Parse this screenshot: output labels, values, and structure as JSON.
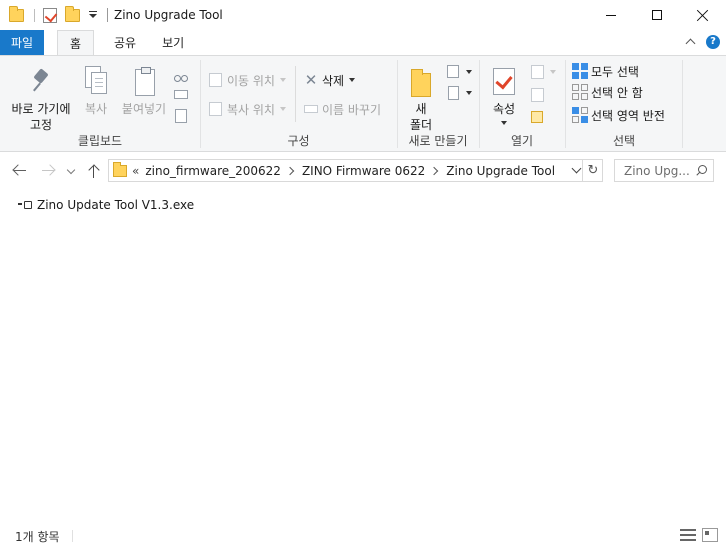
{
  "window": {
    "title": "Zino Upgrade Tool"
  },
  "ribbon_tabs": {
    "file": "파일",
    "home": "홈",
    "share": "공유",
    "view": "보기"
  },
  "clipboard": {
    "pin_label_1": "바로 가기에",
    "pin_label_2": "고정",
    "copy_label": "복사",
    "paste_label": "붙여넣기",
    "group_label": "클립보드"
  },
  "organize": {
    "move_to": "이동 위치",
    "copy_to": "복사 위치",
    "delete": "삭제",
    "rename": "이름 바꾸기",
    "group_label": "구성"
  },
  "new_group": {
    "new_folder_1": "새",
    "new_folder_2": "폴더",
    "group_label": "새로 만들기"
  },
  "open_group": {
    "properties": "속성",
    "group_label": "열기"
  },
  "select_group": {
    "select_all": "모두 선택",
    "select_none": "선택 안 함",
    "invert": "선택 영역 반전",
    "group_label": "선택"
  },
  "address": {
    "overflow": "«",
    "crumbs": [
      "zino_firmware_200622",
      "ZINO Firmware 0622",
      "Zino Upgrade Tool"
    ]
  },
  "search": {
    "placeholder": "Zino Upg..."
  },
  "files": [
    {
      "name": "Zino Update Tool V1.3.exe"
    }
  ],
  "status": {
    "item_count": "1개 항목"
  },
  "colors": {
    "accent": "#1979ca",
    "folder": "#ffd35c",
    "ribbon_bg": "#f5f6f7"
  }
}
